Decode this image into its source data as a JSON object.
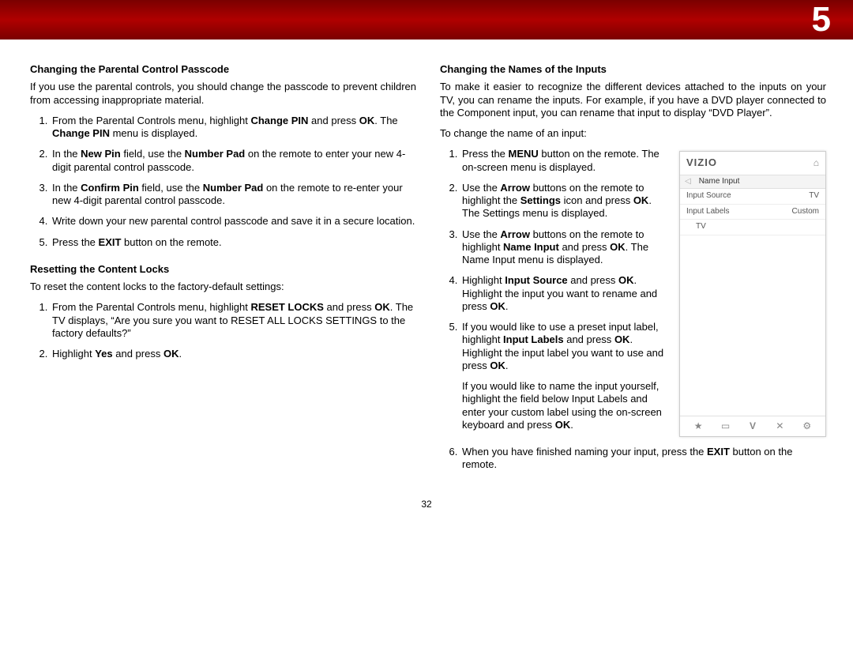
{
  "header": {
    "chapter_number": "5"
  },
  "page_number": "32",
  "left": {
    "section1": {
      "heading": "Changing the Parental Control Passcode",
      "intro": "If you use the parental controls, you should change the passcode to prevent children from accessing inappropriate material.",
      "steps": [
        "From the Parental Controls menu, highlight <b>Change PIN</b> and press <b>OK</b>. The <b>Change PIN</b> menu is displayed.",
        "In the <b>New Pin</b> field, use the <b>Number Pad</b> on the remote to enter your new 4-digit parental control passcode.",
        "In the <b>Confirm Pin</b> field, use the <b>Number Pad</b> on the remote to re-enter your new 4-digit parental control passcode.",
        "Write down your new parental control passcode and save it in a secure location.",
        "Press the <b>EXIT</b> button on the remote."
      ]
    },
    "section2": {
      "heading": "Resetting the Content Locks",
      "intro": "To reset the content locks to the factory-default settings:",
      "steps": [
        "From the Parental Controls menu, highlight <b>RESET LOCKS</b> and press <b>OK</b>. The TV displays, “Are you sure you want to RESET ALL LOCKS SETTINGS to the factory defaults?”",
        "Highlight <b>Yes</b> and press <b>OK</b>."
      ]
    }
  },
  "right": {
    "heading": "Changing the Names of the Inputs",
    "intro": "To make it easier to recognize the different devices attached to the inputs on your TV, you can rename the inputs. For example, if you have a DVD player connected to the Component input, you can rename that input to display “DVD Player”.",
    "lead": "To change the name of an input:",
    "steps_a": [
      "Press the <b>MENU</b> button on the remote. The on-screen menu is displayed.",
      "Use the <b>Arrow</b> buttons on the remote to highlight the <b>Settings</b> icon and press <b>OK</b>. The Settings menu is displayed.",
      "Use the <b>Arrow</b> buttons on the remote to highlight <b>Name Input</b> and press <b>OK</b>. The Name Input menu is displayed.",
      "Highlight <b>Input Source</b> and press <b>OK</b>. Highlight the input you want to rename and press <b>OK</b>.",
      "If you would like to use a preset input label, highlight <b>Input Labels</b> and press <b>OK</b>. Highlight the input label you want to use and press <b>OK</b>."
    ],
    "step5_extra": "If you would like to name the input yourself, highlight the field below Input Labels and enter your custom label using the on-screen keyboard and press <b>OK</b>.",
    "steps_b": [
      "When you have finished naming your input, press the <b>EXIT</b> button on the remote."
    ],
    "figure": {
      "logo": "VIZIO",
      "title": "Name Input",
      "rows": [
        {
          "label": "Input Source",
          "value": "TV"
        },
        {
          "label": "Input Labels",
          "value": "Custom"
        },
        {
          "label": "TV",
          "value": ""
        }
      ],
      "icons": {
        "star": "★",
        "box": "▭",
        "v": "V",
        "x": "✕",
        "gear": "⚙"
      }
    }
  }
}
